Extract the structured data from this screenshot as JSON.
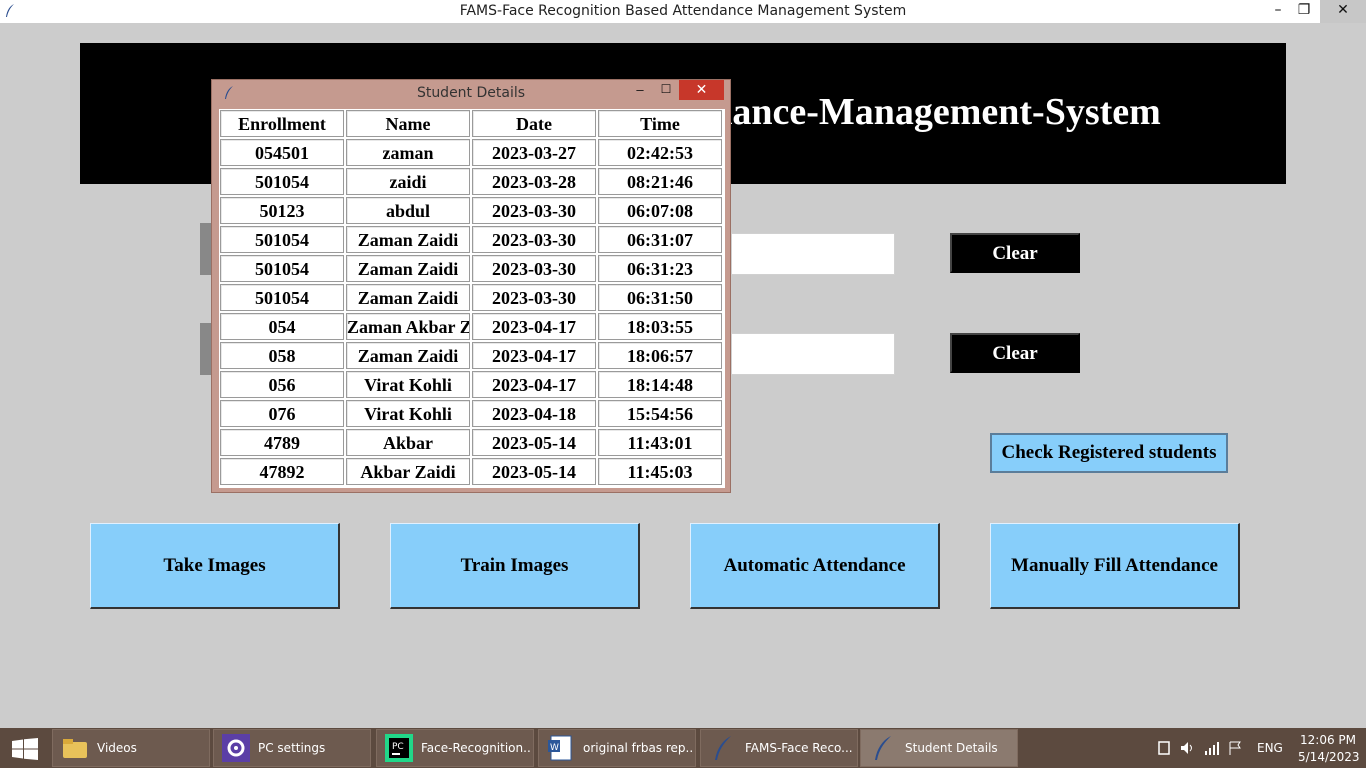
{
  "window": {
    "title": "FAMS-Face Recognition Based Attendance Management System",
    "minimize": "–",
    "maximize": "❐",
    "close": "✕"
  },
  "banner": {
    "text": "Face-Recognition-Based-Attendance-Management-System"
  },
  "buttons": {
    "clear1": "Clear",
    "clear2": "Clear",
    "check_registered": "Check Registered students",
    "take_images": "Take Images",
    "train_images": "Train Images",
    "automatic_attendance": "Automatic Attendance",
    "manual_attendance": "Manually Fill Attendance"
  },
  "popup": {
    "title": "Student Details",
    "minimize": "–",
    "maximize": "☐",
    "close": "✕",
    "headers": [
      "Enrollment",
      "Name",
      "Date",
      "Time"
    ],
    "rows": [
      [
        "054501",
        "zaman",
        "2023-03-27",
        "02:42:53"
      ],
      [
        "501054",
        "zaidi",
        "2023-03-28",
        "08:21:46"
      ],
      [
        "50123",
        "abdul",
        "2023-03-30",
        "06:07:08"
      ],
      [
        "501054",
        "Zaman Zaidi",
        "2023-03-30",
        "06:31:07"
      ],
      [
        "501054",
        "Zaman Zaidi",
        "2023-03-30",
        "06:31:23"
      ],
      [
        "501054",
        "Zaman Zaidi",
        "2023-03-30",
        "06:31:50"
      ],
      [
        "054",
        "Zaman Akbar Zaidi",
        "2023-04-17",
        "18:03:55"
      ],
      [
        "058",
        "Zaman Zaidi",
        "2023-04-17",
        "18:06:57"
      ],
      [
        "056",
        "Virat Kohli",
        "2023-04-17",
        "18:14:48"
      ],
      [
        "076",
        "Virat Kohli",
        "2023-04-18",
        "15:54:56"
      ],
      [
        "4789",
        "Akbar",
        "2023-05-14",
        "11:43:01"
      ],
      [
        "47892",
        "Akbar Zaidi",
        "2023-05-14",
        "11:45:03"
      ]
    ]
  },
  "taskbar": {
    "items": [
      {
        "label": "Videos",
        "icon": "folder-icon"
      },
      {
        "label": "PC settings",
        "icon": "gear-icon"
      },
      {
        "label": "Face-Recognition...",
        "icon": "pycharm-icon"
      },
      {
        "label": "original frbas rep...",
        "icon": "word-icon"
      },
      {
        "label": "FAMS-Face Reco...",
        "icon": "feather-icon"
      },
      {
        "label": "Student Details",
        "icon": "feather-icon"
      }
    ],
    "language": "ENG",
    "time": "12:06 PM",
    "date": "5/14/2023"
  }
}
